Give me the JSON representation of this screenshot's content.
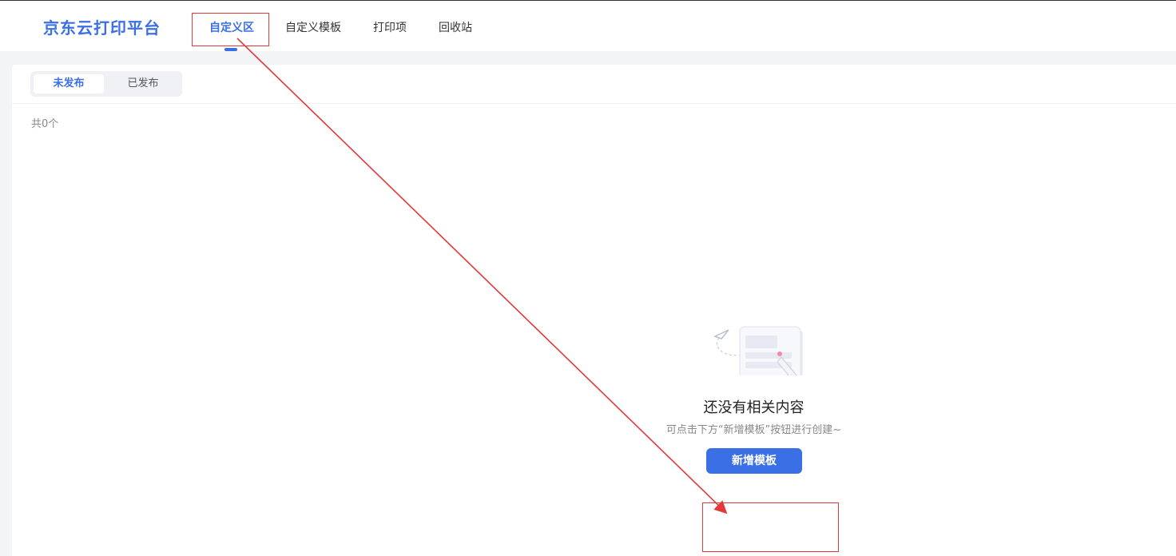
{
  "brand": {
    "title": "京东云打印平台"
  },
  "nav": {
    "tabs": [
      {
        "label": "自定义区",
        "active": true
      },
      {
        "label": "自定义模板",
        "active": false
      },
      {
        "label": "打印项",
        "active": false
      },
      {
        "label": "回收站",
        "active": false
      }
    ]
  },
  "segment": {
    "unpublished": "未发布",
    "published": "已发布",
    "selected": "未发布"
  },
  "list": {
    "count_text": "共0个"
  },
  "empty": {
    "title": "还没有相关内容",
    "subtitle": "可点击下方“新增模板”按钮进行创建~",
    "button": "新增模板"
  },
  "colors": {
    "accent": "#3b6fe6",
    "annotation": "#e23a3a"
  },
  "icons": [
    "paper-plane-icon",
    "pencil-icon",
    "person-with-laptop-icon"
  ]
}
